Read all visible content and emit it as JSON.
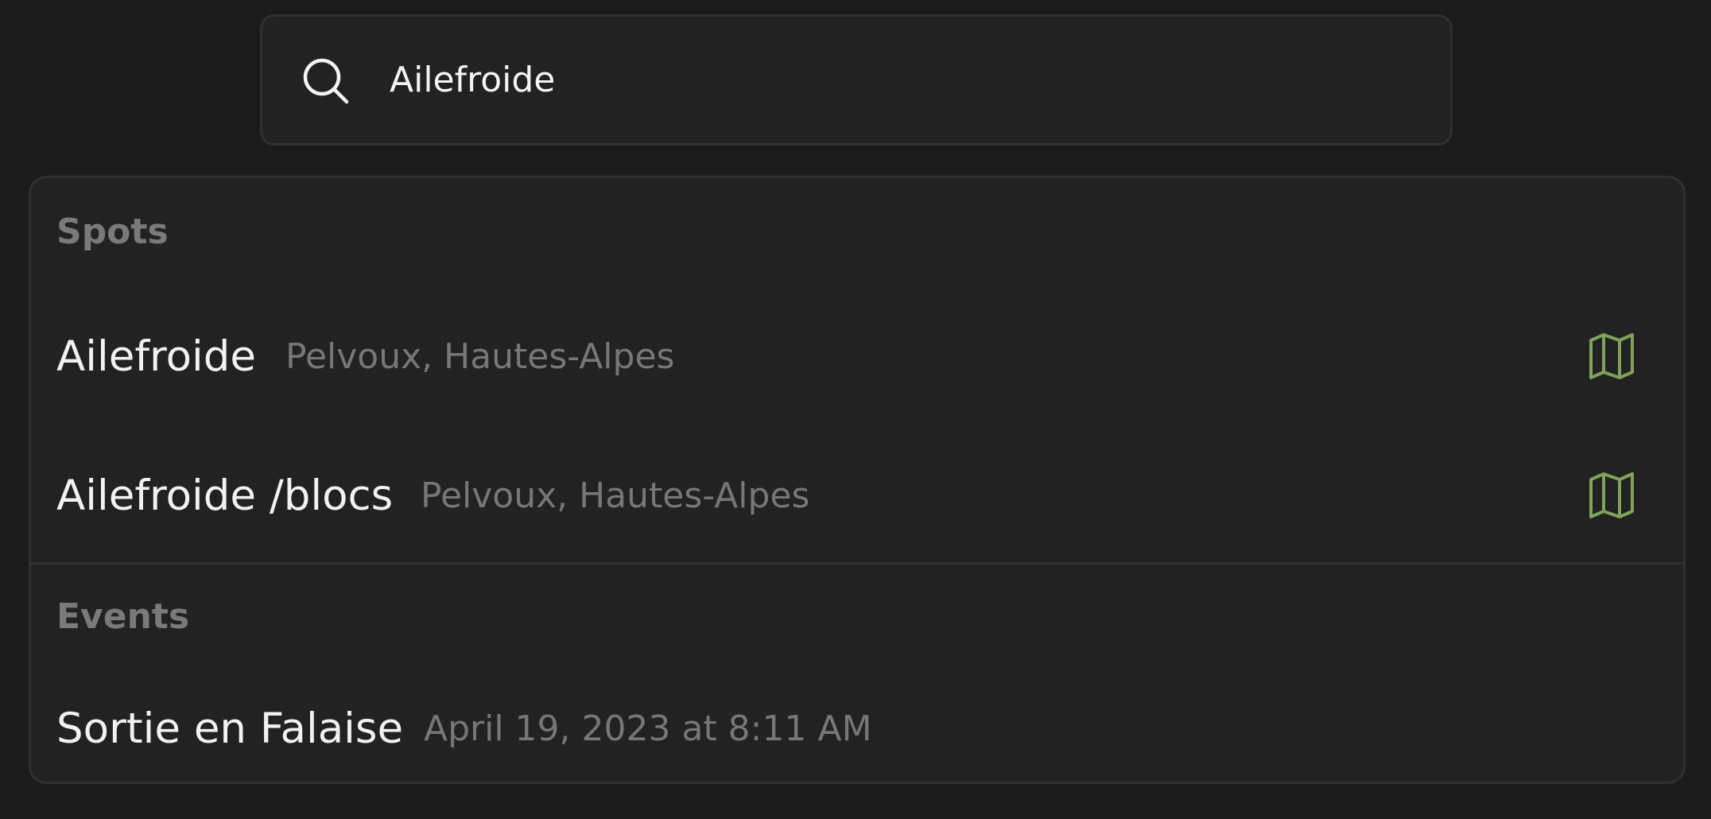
{
  "search": {
    "query": "Ailefroide"
  },
  "sections": {
    "spots": {
      "header": "Spots",
      "items": [
        {
          "title": "Ailefroide",
          "subtitle": "Pelvoux, Hautes-Alpes",
          "icon": "map-icon"
        },
        {
          "title": "Ailefroide /blocs",
          "subtitle": "Pelvoux, Hautes-Alpes",
          "icon": "map-icon"
        }
      ]
    },
    "events": {
      "header": "Events",
      "items": [
        {
          "title": "Sortie en Falaise",
          "subtitle": "April 19, 2023 at 8:11 AM"
        }
      ]
    }
  },
  "colors": {
    "accent": "#7fa35a",
    "background": "#1b1b1b",
    "panel": "#222222"
  }
}
